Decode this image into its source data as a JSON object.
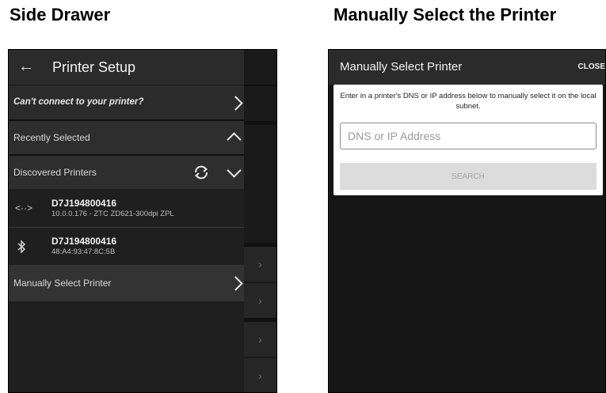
{
  "headings": {
    "left": "Side Drawer",
    "right": "Manually Select the Printer"
  },
  "drawer": {
    "title": "Printer Setup",
    "cant_connect": "Can't connect to your printer?",
    "recently_selected": "Recently Selected",
    "discovered_printers": "Discovered Printers",
    "printers": [
      {
        "icon": "network-icon",
        "name": "D7J194800416",
        "detail": "10.0.0.176 - ZTC ZD621-300dpi ZPL"
      },
      {
        "icon": "bluetooth-icon",
        "name": "D7J194800416",
        "detail": "48:A4:93:47:8C:5B"
      }
    ],
    "manually_select": "Manually Select Printer"
  },
  "manual": {
    "title": "Manually Select Printer",
    "close_label": "CLOSE",
    "description": "Enter in a printer's DNS or IP address below to manually select it on the local subnet.",
    "input_placeholder": "DNS or IP Address",
    "search_label": "SEARCH"
  },
  "colors": {
    "drawer_bg": "#1f1f1f",
    "header_bg": "#2b2b2b",
    "card_bg": "#ffffff",
    "search_disabled": "#dcdcdc"
  }
}
